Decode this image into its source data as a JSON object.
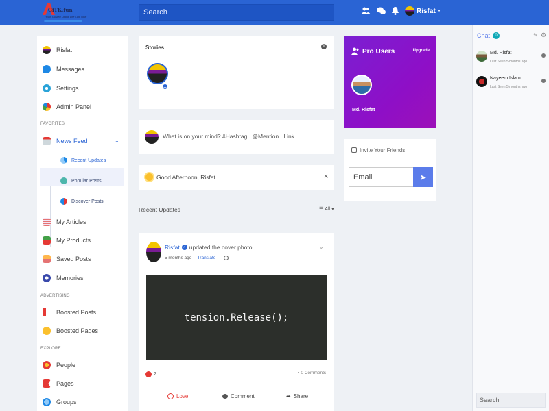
{
  "header": {
    "logo_name": "GiTK.fun",
    "logo_tagline": "Your Trusted Digital Life Link Now",
    "search_placeholder": "Search",
    "user_name": "Risfat",
    "icons": [
      "friends-icon",
      "messages-icon",
      "notifications-icon",
      "caret-down-icon"
    ]
  },
  "sidebar": {
    "items": [
      {
        "label": "Risfat",
        "icon": "profile-icon"
      },
      {
        "label": "Messages",
        "icon": "messages-icon"
      },
      {
        "label": "Settings",
        "icon": "settings-icon"
      },
      {
        "label": "Admin Panel",
        "icon": "admin-panel-icon"
      }
    ],
    "sections": {
      "favorites": "FAVORITES",
      "advertising": "ADVERTISING",
      "explore": "EXPLORE"
    },
    "news_feed": {
      "label": "News Feed",
      "subitems": [
        "Recent Updates",
        "Popular Posts",
        "Discover Posts"
      ]
    },
    "favorites_items": [
      "My Articles",
      "My Products",
      "Saved Posts",
      "Memories"
    ],
    "advertising_items": [
      "Boosted Posts",
      "Boosted Pages"
    ],
    "explore_items": [
      "People",
      "Pages",
      "Groups"
    ]
  },
  "stories": {
    "title": "Stories"
  },
  "composer": {
    "placeholder": "What is on your mind? #Hashtag.. @Mention.. Link.."
  },
  "greeting": {
    "text": "Good Afternoon, Risfat",
    "close": "×"
  },
  "feed_header": {
    "title": "Recent Updates",
    "filter": "All"
  },
  "post": {
    "author": "Risfat",
    "action": "updated the cover photo",
    "time": "5 months ago",
    "translate": "Translate",
    "code_text": "tension.Release();",
    "likes": "2",
    "comments": "0 Comments",
    "buttons": {
      "love": "Love",
      "comment": "Comment",
      "share": "Share"
    }
  },
  "pro_users": {
    "title": "Pro Users",
    "upgrade": "Upgrade",
    "user_name": "Md. Risfat"
  },
  "invite": {
    "title": "Invite Your Friends",
    "email_placeholder": "Email"
  },
  "chat": {
    "title": "Chat",
    "count": "0",
    "contacts": [
      {
        "name": "Md. Risfat",
        "status": "Last Seen 5 months ago"
      },
      {
        "name": "Nayeem Islam",
        "status": "Last Seen 5 months ago"
      }
    ],
    "search_placeholder": "Search"
  },
  "colors": {
    "primary": "#2a64d4",
    "pro_gradient_start": "#7b1fd2",
    "pro_gradient_end": "#9c10b8",
    "love": "#e53935"
  }
}
